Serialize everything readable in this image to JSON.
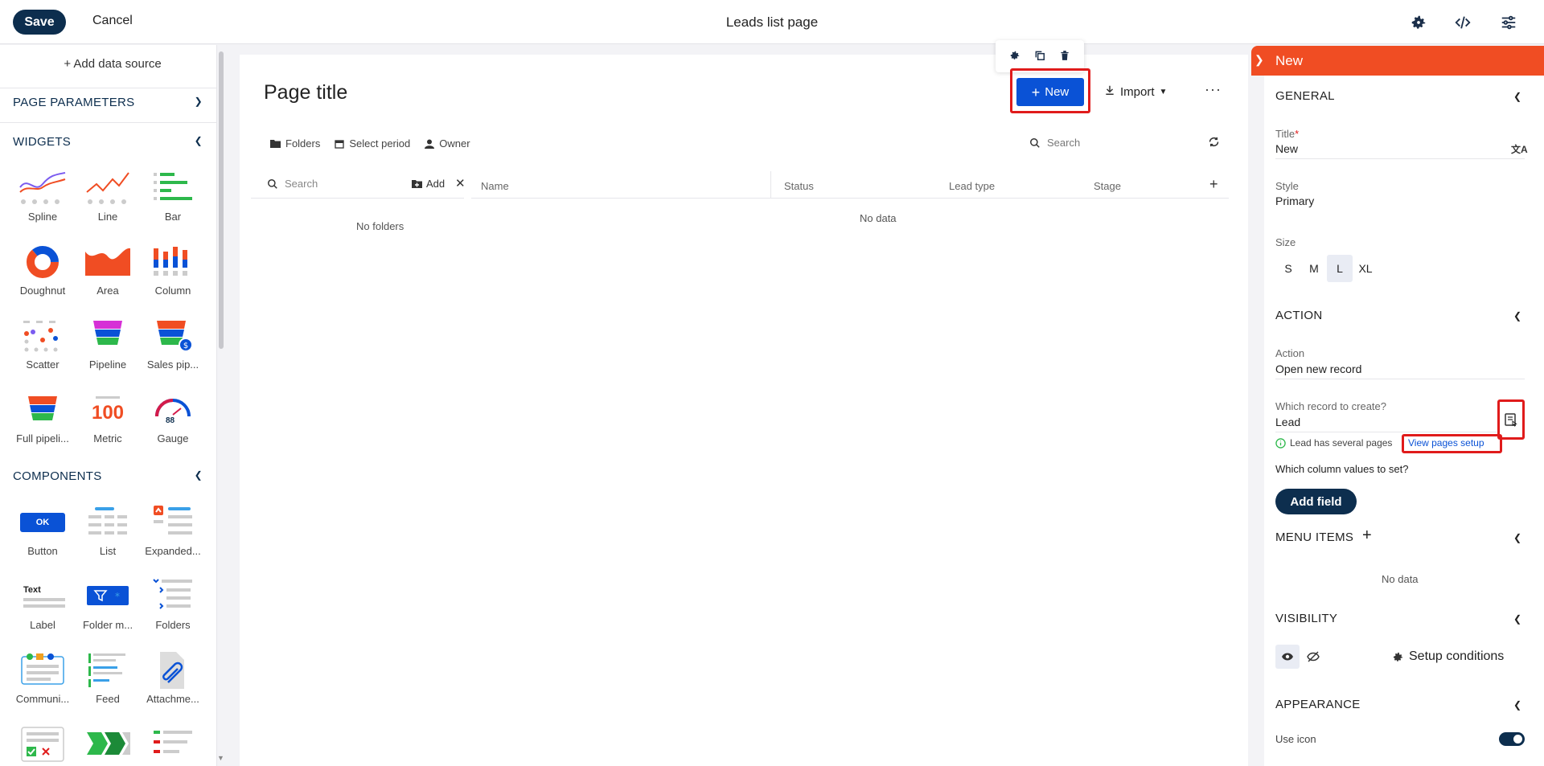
{
  "topbar": {
    "save": "Save",
    "cancel": "Cancel",
    "title": "Leads list page"
  },
  "left": {
    "add_data_source": "+ Add data source",
    "page_parameters": "PAGE PARAMETERS",
    "widgets_title": "WIDGETS",
    "widgets": [
      {
        "label": "Spline"
      },
      {
        "label": "Line"
      },
      {
        "label": "Bar"
      },
      {
        "label": "Doughnut"
      },
      {
        "label": "Area"
      },
      {
        "label": "Column"
      },
      {
        "label": "Scatter"
      },
      {
        "label": "Pipeline"
      },
      {
        "label": "Sales pip..."
      },
      {
        "label": "Full pipeli..."
      },
      {
        "label": "Metric"
      },
      {
        "label": "Gauge"
      }
    ],
    "components_title": "COMPONENTS",
    "components": [
      {
        "label": "Button"
      },
      {
        "label": "List"
      },
      {
        "label": "Expanded..."
      },
      {
        "label": "Label"
      },
      {
        "label": "Folder m..."
      },
      {
        "label": "Folders"
      },
      {
        "label": "Communi..."
      },
      {
        "label": "Feed"
      },
      {
        "label": "Attachme..."
      }
    ],
    "metric_value": "100",
    "gauge_value": "88",
    "button_icon_text": "OK",
    "label_icon_text": "Text"
  },
  "canvas": {
    "page_title": "Page title",
    "new_button": "New",
    "import": "Import",
    "filters": {
      "folders": "Folders",
      "period": "Select period",
      "owner": "Owner"
    },
    "search_placeholder": "Search",
    "folder_search_placeholder": "Search",
    "folder_add": "Add",
    "no_folders": "No folders",
    "columns": [
      "Name",
      "Status",
      "Lead type",
      "Stage"
    ],
    "no_data": "No data"
  },
  "right": {
    "header": "New",
    "general": "GENERAL",
    "title_label": "Title",
    "title_value": "New",
    "style_label": "Style",
    "style_value": "Primary",
    "size_label": "Size",
    "sizes": [
      "S",
      "M",
      "L",
      "XL"
    ],
    "selected_size": "L",
    "action_section": "ACTION",
    "action_label": "Action",
    "action_value": "Open new record",
    "record_label": "Which record to create?",
    "record_value": "Lead",
    "hint": "Lead has several pages",
    "hint_link": "View pages setup",
    "columns_label": "Which column values to set?",
    "add_field": "Add field",
    "menu_items": "MENU ITEMS",
    "menu_no_data": "No data",
    "visibility": "VISIBILITY",
    "setup_conditions": "Setup conditions",
    "appearance": "APPEARANCE",
    "use_icon": "Use icon",
    "use_icon_enabled": true
  },
  "colors": {
    "navy": "#0d2e4e",
    "primary_blue": "#0a52d6",
    "header_orange": "#f04d23",
    "highlight_red": "#e01b1b"
  }
}
